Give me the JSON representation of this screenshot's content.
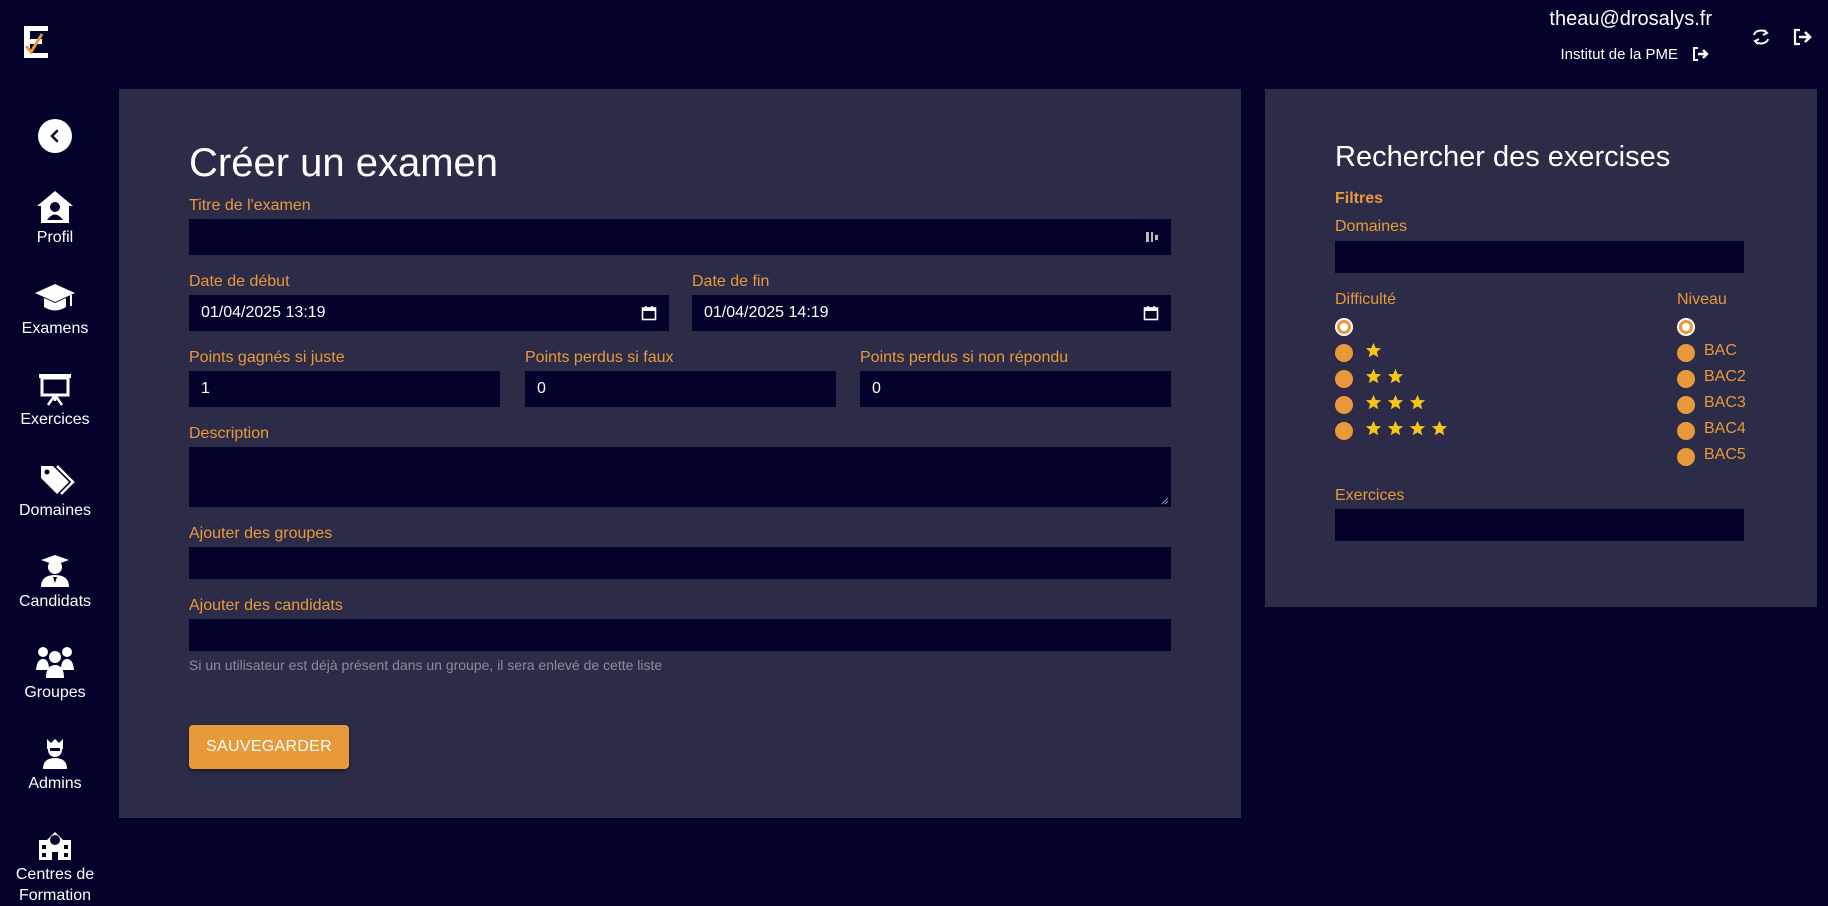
{
  "header": {
    "user_email": "theau@drosalys.fr",
    "org_name": "Institut de la PME",
    "icons": [
      "logo-icon",
      "switch-icon",
      "logout-icon",
      "org-logout-icon"
    ]
  },
  "sidebar": {
    "items": [
      {
        "label": "Profil",
        "icon": "profile-icon"
      },
      {
        "label": "Examens",
        "icon": "graduation-cap-icon"
      },
      {
        "label": "Exercices",
        "icon": "presentation-icon"
      },
      {
        "label": "Domaines",
        "icon": "tags-icon"
      },
      {
        "label": "Candidats",
        "icon": "student-icon"
      },
      {
        "label": "Groupes",
        "icon": "group-icon"
      },
      {
        "label": "Admins",
        "icon": "admin-icon"
      },
      {
        "label_line1": "Centres de",
        "label_line2": "Formation",
        "icon": "school-icon"
      }
    ]
  },
  "form": {
    "title": "Créer un examen",
    "exam_title_label": "Titre de l'examen",
    "exam_title_value": "",
    "start_date_label": "Date de début",
    "start_date_value": "01/04/2025 13:19",
    "end_date_label": "Date de fin",
    "end_date_value": "01/04/2025 14:19",
    "points_correct_label": "Points gagnés si juste",
    "points_correct_value": "1",
    "points_wrong_label": "Points perdus si faux",
    "points_wrong_value": "0",
    "points_unanswered_label": "Points perdus si non répondu",
    "points_unanswered_value": "0",
    "description_label": "Description",
    "description_value": "",
    "groups_label": "Ajouter des groupes",
    "candidates_label": "Ajouter des candidats",
    "helper_text": "Si un utilisateur est déjà présent dans un groupe, il sera enlevé de cette liste",
    "save_label": "SAUVEGARDER"
  },
  "search": {
    "title": "Rechercher des exercises",
    "filters_label": "Filtres",
    "domains_label": "Domaines",
    "difficulty_label": "Difficulté",
    "difficulty_options": [
      0,
      1,
      2,
      3,
      4
    ],
    "difficulty_selected": 0,
    "level_label": "Niveau",
    "level_options": [
      "",
      "BAC",
      "BAC2",
      "BAC3",
      "BAC4",
      "BAC5"
    ],
    "level_selected": 0,
    "exercises_label": "Exercices"
  },
  "colors": {
    "background": "#03022a",
    "panel": "#2c2c48",
    "accent": "#e8993a",
    "star": "#f5c518"
  }
}
